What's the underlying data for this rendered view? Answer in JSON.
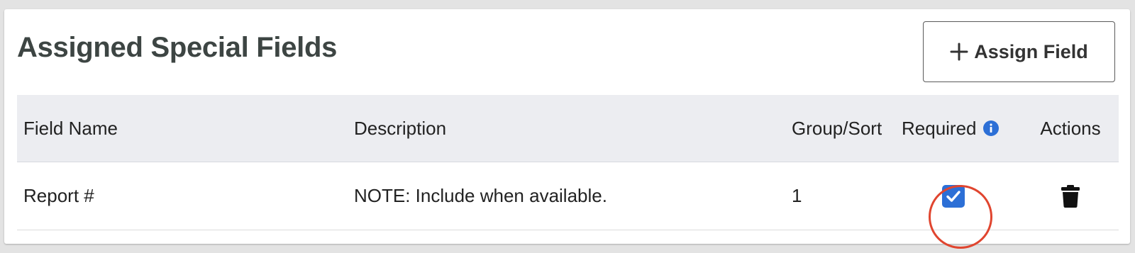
{
  "header": {
    "title": "Assigned Special Fields",
    "assign_button_label": "Assign Field",
    "assign_button_icon": "plus-icon"
  },
  "table": {
    "columns": [
      "Field Name",
      "Description",
      "Group/Sort",
      "Required",
      "Actions"
    ],
    "required_info_icon": "info-icon",
    "rows": [
      {
        "field_name": "Report #",
        "description": "NOTE: Include when available.",
        "group_sort": "1",
        "required": true,
        "action_icon": "trash-icon"
      }
    ]
  },
  "colors": {
    "title": "#3d4543",
    "header_bg": "#ecedf1",
    "checkbox": "#2c6fd6",
    "info_icon": "#2c6fd6",
    "highlight_circle": "#e0452f"
  }
}
